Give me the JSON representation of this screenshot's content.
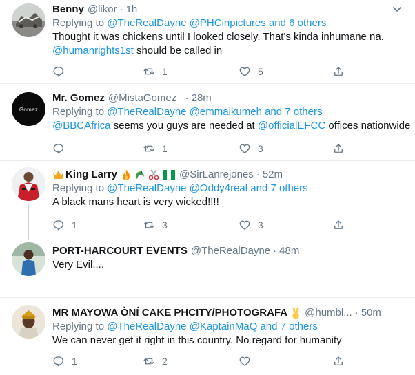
{
  "tweets": [
    {
      "name": "Benny",
      "handle": "@likor",
      "time": "1h",
      "replying_prefix": "Replying to",
      "replying_to": "@TheRealDayne @PHCinpictures and 6 others",
      "text_line1": "Thought it was chickens until I looked closely. That's kinda inhumane na.",
      "text_line2_link": "@humanrights1st",
      "text_line2_rest": " should be called in",
      "replies": "",
      "retweets": "1",
      "likes": "5"
    },
    {
      "name": "Mr. Gomez",
      "handle": "@MistaGomez_",
      "time": "28m",
      "replying_prefix": "Replying to",
      "replying_to": "@TheRealDayne @emmaikumeh and 7 others",
      "text_link1": "@BBCAfrica",
      "text_mid": " seems you guys are needed at ",
      "text_link2": "@officialEFCC",
      "text_end": " offices nationwide",
      "avatar_text": "Gomez",
      "replies": "",
      "retweets": "1",
      "likes": "3"
    },
    {
      "name": "King Larry",
      "handle": "@SirLanrejones",
      "time": "52m",
      "replying_prefix": "Replying to",
      "replying_to": "@TheRealDayne @Oddy4real and 7 others",
      "text": "A black mans heart is very wicked!!!!",
      "replies": "1",
      "retweets": "3",
      "likes": "3"
    },
    {
      "name": "PORT-HARCOURT EVENTS",
      "handle": "@TheRealDayne",
      "time": "48m",
      "text": "Very Evil...."
    },
    {
      "name": "MR MAYOWA ÒNÍ CAKE PHCITY/PHOTOGRAFA",
      "handle": "@humbl...",
      "time": "50m",
      "replying_prefix": "Replying to",
      "replying_to": "@TheRealDayne @KaptainMaQ and 7 others",
      "text": "We can never get it right in this country. No regard for humanity",
      "replies": "1",
      "retweets": "2",
      "likes": ""
    }
  ],
  "colors": {
    "link": "#1b95e0",
    "muted": "#657786",
    "text": "#14171a",
    "divider": "#e6ecf0"
  },
  "icons": [
    "reply-icon",
    "retweet-icon",
    "like-icon",
    "share-icon",
    "caret-down-icon"
  ]
}
